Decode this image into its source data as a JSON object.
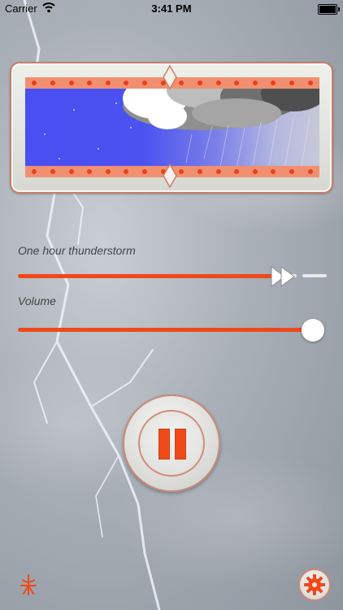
{
  "status_bar": {
    "carrier": "Carrier",
    "time": "3:41 PM",
    "icons": [
      "wifi-icon",
      "battery-icon"
    ]
  },
  "timer_display": {
    "scene": [
      "night-sky",
      "storm-clouds",
      "rain"
    ]
  },
  "sound_slider": {
    "label": "One hour thunderstorm",
    "progress": 0.85,
    "thumb_icon": "fast-forward-icon"
  },
  "volume_slider": {
    "label": "Volume",
    "level": 1.0
  },
  "playback": {
    "state": "playing",
    "button_icon": "pause-icon"
  },
  "footer": {
    "logo_icon": "app-logo-icon",
    "settings_icon": "gear-icon"
  },
  "colors": {
    "accent": "#F0481B",
    "frame_border": "#C77F6A",
    "night_sky": "#4A4FF1"
  }
}
